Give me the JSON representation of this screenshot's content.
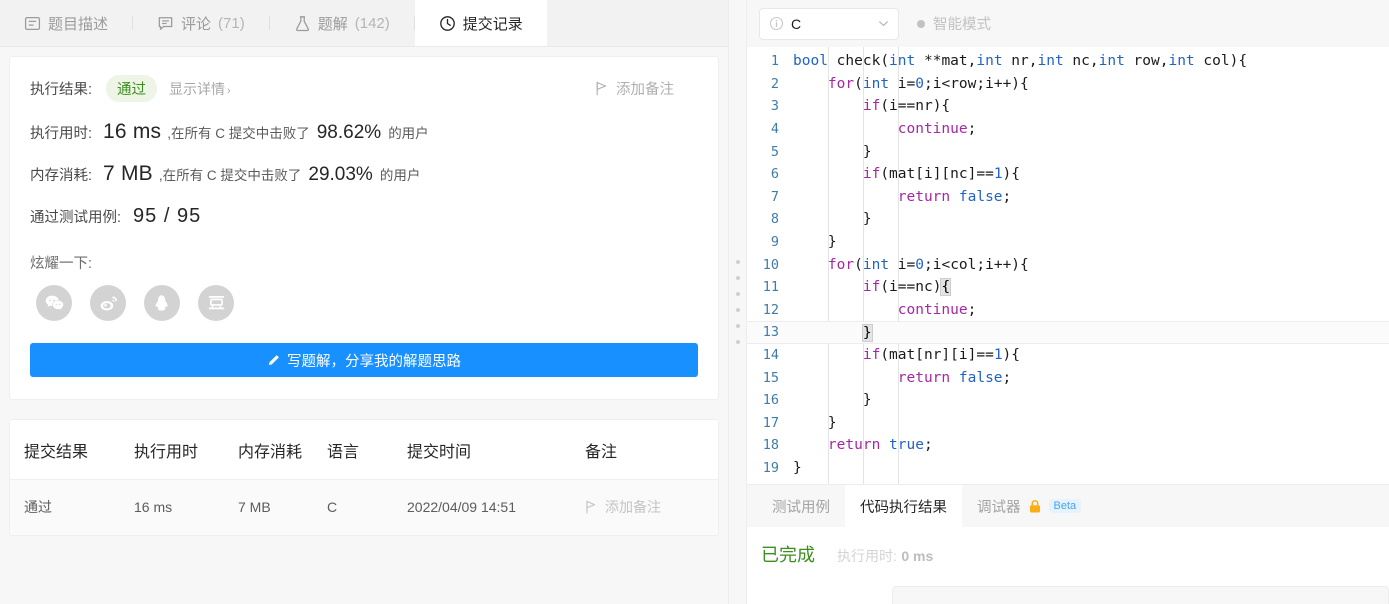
{
  "tabs": [
    {
      "label": "题目描述",
      "count": "",
      "icon": "document-icon",
      "active": false
    },
    {
      "label": "评论",
      "count": "(71)",
      "icon": "comment-icon",
      "active": false
    },
    {
      "label": "题解",
      "count": "(142)",
      "icon": "flask-icon",
      "active": false
    },
    {
      "label": "提交记录",
      "count": "",
      "icon": "clock-icon",
      "active": true
    }
  ],
  "result": {
    "result_label": "执行结果:",
    "status": "通过",
    "detail_link": "显示详情",
    "detail_chevron": "›",
    "add_note": "添加备注",
    "runtime": {
      "label": "执行用时:",
      "value": "16 ms",
      "mid": ",在所有 C 提交中击败了",
      "percent": "98.62%",
      "tail": "的用户"
    },
    "memory": {
      "label": "内存消耗:",
      "value": "7 MB",
      "mid": ",在所有 C 提交中击败了",
      "percent": "29.03%",
      "tail": "的用户"
    },
    "cases": {
      "label": "通过测试用例:",
      "value": "95 / 95"
    },
    "share_label": "炫耀一下:",
    "share_icons": [
      "wechat-icon",
      "weibo-icon",
      "qq-icon",
      "douban-icon"
    ],
    "write_button": "写题解，分享我的解题思路"
  },
  "submissions": {
    "headers": [
      "提交结果",
      "执行用时",
      "内存消耗",
      "语言",
      "提交时间",
      "备注"
    ],
    "rows": [
      {
        "status": "通过",
        "runtime": "16 ms",
        "memory": "7 MB",
        "language": "C",
        "time": "2022/04/09 14:51",
        "note": "添加备注"
      }
    ]
  },
  "editor": {
    "language": "C",
    "smart_mode": "智能模式",
    "lines": [
      {
        "n": "1",
        "tokens": [
          [
            "ty",
            "bool"
          ],
          [
            "id",
            " "
          ],
          [
            "fn",
            "check"
          ],
          [
            "id",
            "("
          ],
          [
            "ty",
            "int"
          ],
          [
            "id",
            " **mat,"
          ],
          [
            "ty",
            "int"
          ],
          [
            "id",
            " nr,"
          ],
          [
            "ty",
            "int"
          ],
          [
            "id",
            " nc,"
          ],
          [
            "ty",
            "int"
          ],
          [
            "id",
            " row,"
          ],
          [
            "ty",
            "int"
          ],
          [
            "id",
            " col){"
          ]
        ]
      },
      {
        "n": "2",
        "tokens": [
          [
            "id",
            "    "
          ],
          [
            "k",
            "for"
          ],
          [
            "id",
            "("
          ],
          [
            "ty",
            "int"
          ],
          [
            "id",
            " i="
          ],
          [
            "nu",
            "0"
          ],
          [
            "id",
            ";i<row;i++){"
          ]
        ]
      },
      {
        "n": "3",
        "tokens": [
          [
            "id",
            "        "
          ],
          [
            "k",
            "if"
          ],
          [
            "id",
            "(i==nr){"
          ]
        ]
      },
      {
        "n": "4",
        "tokens": [
          [
            "id",
            "            "
          ],
          [
            "k",
            "continue"
          ],
          [
            "id",
            ";"
          ]
        ]
      },
      {
        "n": "5",
        "tokens": [
          [
            "id",
            "        }"
          ]
        ]
      },
      {
        "n": "6",
        "tokens": [
          [
            "id",
            "        "
          ],
          [
            "k",
            "if"
          ],
          [
            "id",
            "(mat[i][nc]=="
          ],
          [
            "nu",
            "1"
          ],
          [
            "id",
            "){"
          ]
        ]
      },
      {
        "n": "7",
        "tokens": [
          [
            "id",
            "            "
          ],
          [
            "k",
            "return"
          ],
          [
            "id",
            " "
          ],
          [
            "ty",
            "false"
          ],
          [
            "id",
            ";"
          ]
        ]
      },
      {
        "n": "8",
        "tokens": [
          [
            "id",
            "        }"
          ]
        ]
      },
      {
        "n": "9",
        "tokens": [
          [
            "id",
            "    }"
          ]
        ]
      },
      {
        "n": "10",
        "tokens": [
          [
            "id",
            "    "
          ],
          [
            "k",
            "for"
          ],
          [
            "id",
            "("
          ],
          [
            "ty",
            "int"
          ],
          [
            "id",
            " i="
          ],
          [
            "nu",
            "0"
          ],
          [
            "id",
            ";i<col;i++){"
          ]
        ]
      },
      {
        "n": "11",
        "tokens": [
          [
            "id",
            "        "
          ],
          [
            "k",
            "if"
          ],
          [
            "id",
            "(i==nc)"
          ],
          [
            "bm",
            "{"
          ]
        ]
      },
      {
        "n": "12",
        "tokens": [
          [
            "id",
            "            "
          ],
          [
            "k",
            "continue"
          ],
          [
            "id",
            ";"
          ]
        ]
      },
      {
        "n": "13",
        "tokens": [
          [
            "id",
            "        "
          ],
          [
            "bm",
            "}"
          ]
        ],
        "current": true
      },
      {
        "n": "14",
        "tokens": [
          [
            "id",
            "        "
          ],
          [
            "k",
            "if"
          ],
          [
            "id",
            "(mat[nr][i]=="
          ],
          [
            "nu",
            "1"
          ],
          [
            "id",
            "){"
          ]
        ]
      },
      {
        "n": "15",
        "tokens": [
          [
            "id",
            "            "
          ],
          [
            "k",
            "return"
          ],
          [
            "id",
            " "
          ],
          [
            "ty",
            "false"
          ],
          [
            "id",
            ";"
          ]
        ]
      },
      {
        "n": "16",
        "tokens": [
          [
            "id",
            "        }"
          ]
        ]
      },
      {
        "n": "17",
        "tokens": [
          [
            "id",
            "    }"
          ]
        ]
      },
      {
        "n": "18",
        "tokens": [
          [
            "id",
            "    "
          ],
          [
            "k",
            "return"
          ],
          [
            "id",
            " "
          ],
          [
            "ty",
            "true"
          ],
          [
            "id",
            ";"
          ]
        ]
      },
      {
        "n": "19",
        "tokens": [
          [
            "id",
            "}"
          ]
        ]
      }
    ]
  },
  "console": {
    "tabs": [
      {
        "label": "测试用例",
        "active": false,
        "lock": false,
        "beta": ""
      },
      {
        "label": "代码执行结果",
        "active": true,
        "lock": false,
        "beta": ""
      },
      {
        "label": "调试器",
        "active": false,
        "lock": true,
        "beta": "Beta"
      }
    ],
    "status": "已完成",
    "runtime_label": "执行用时:",
    "runtime_value": "0 ms"
  },
  "colors": {
    "accent_blue": "#1890ff",
    "pass_green": "#3c8f1e",
    "keyword_purple": "#a626a4",
    "type_blue": "#2163c4",
    "gutter_blue": "#3f7ca8"
  }
}
